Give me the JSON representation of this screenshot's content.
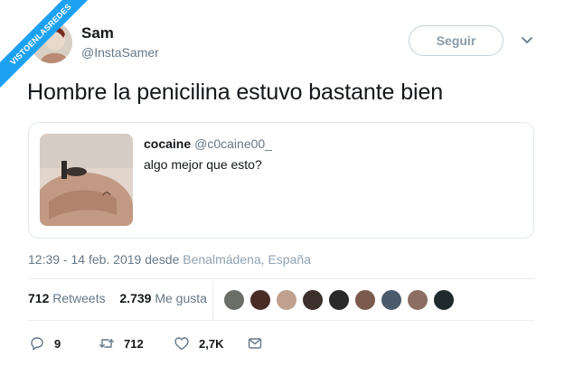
{
  "watermark": "VISTOENLASREDES",
  "author": {
    "name": "Sam",
    "handle": "@InstaSamer"
  },
  "follow_label": "Seguir",
  "tweet_text": "Hombre la penicilina estuvo bastante bien",
  "quote": {
    "name": "cocaine",
    "handle": "@c0caine00_",
    "text": "algo mejor que esto?"
  },
  "meta": {
    "datetime": "12:39 - 14 feb. 2019",
    "from": "desde",
    "location": "Benalmádena, España"
  },
  "stats": {
    "retweets_count": "712",
    "retweets_label": "Retweets",
    "likes_count": "2.739",
    "likes_label": "Me gusta"
  },
  "actions": {
    "reply_count": "9",
    "retweet_count": "712",
    "like_count": "2,7K"
  },
  "icons": [
    "chevron-down-icon",
    "reply-icon",
    "retweet-icon",
    "heart-icon",
    "message-icon"
  ],
  "colors": {
    "accent": "#1da1f2",
    "muted": "#657786",
    "border": "#e1e8ed"
  }
}
